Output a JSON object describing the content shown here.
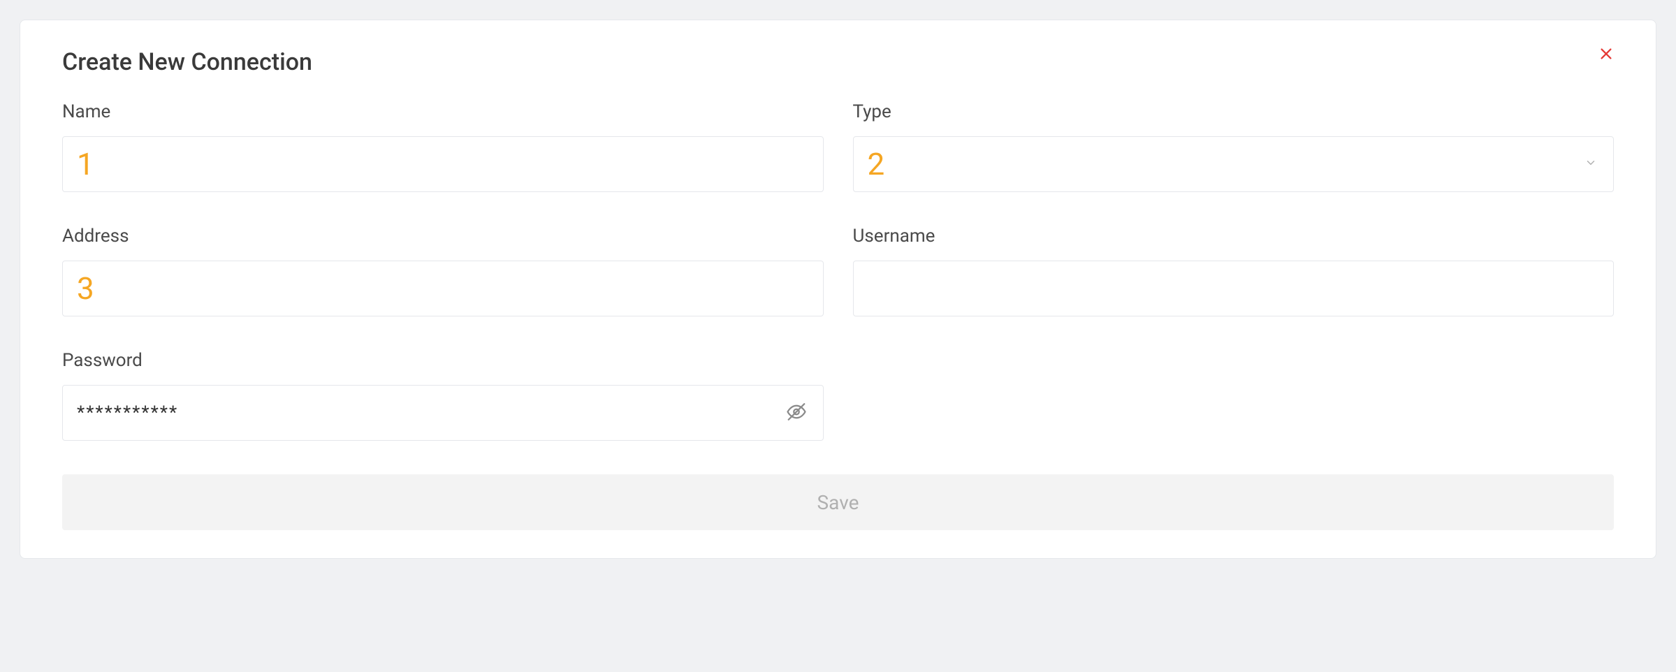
{
  "modal": {
    "title": "Create New Connection",
    "close_icon": "close-icon"
  },
  "form": {
    "name": {
      "label": "Name",
      "value": "1"
    },
    "type": {
      "label": "Type",
      "value": "2"
    },
    "address": {
      "label": "Address",
      "value": "3"
    },
    "username": {
      "label": "Username",
      "value": ""
    },
    "password": {
      "label": "Password",
      "value": "***********"
    },
    "save_label": "Save"
  }
}
